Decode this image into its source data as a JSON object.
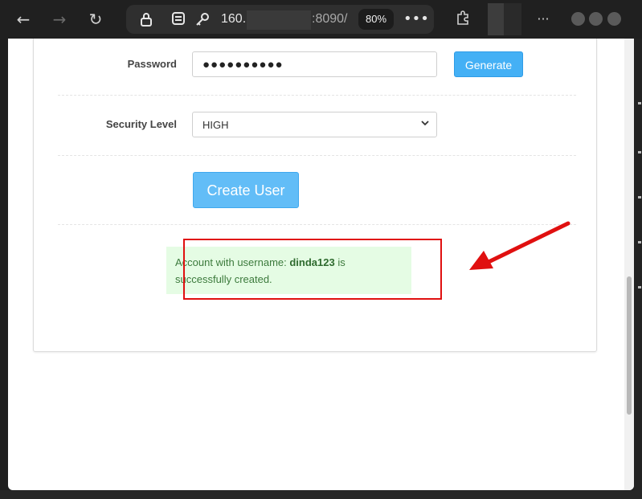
{
  "browser": {
    "url_visible_start": "160.",
    "url_visible_end": ":8090/",
    "zoom_level": "80%"
  },
  "form": {
    "password_label": "Password",
    "password_value": "●●●●●●●●●●",
    "generate_label": "Generate",
    "security_level_label": "Security Level",
    "security_level_value": "HIGH",
    "create_user_label": "Create User"
  },
  "alert": {
    "prefix": "Account with username: ",
    "username": "dinda123",
    "suffix": " is successfully created."
  },
  "colors": {
    "primary_button": "#44b0f5",
    "success_background": "#e5fce4",
    "success_text": "#3c7a3c",
    "annotation_red": "#e01010"
  }
}
